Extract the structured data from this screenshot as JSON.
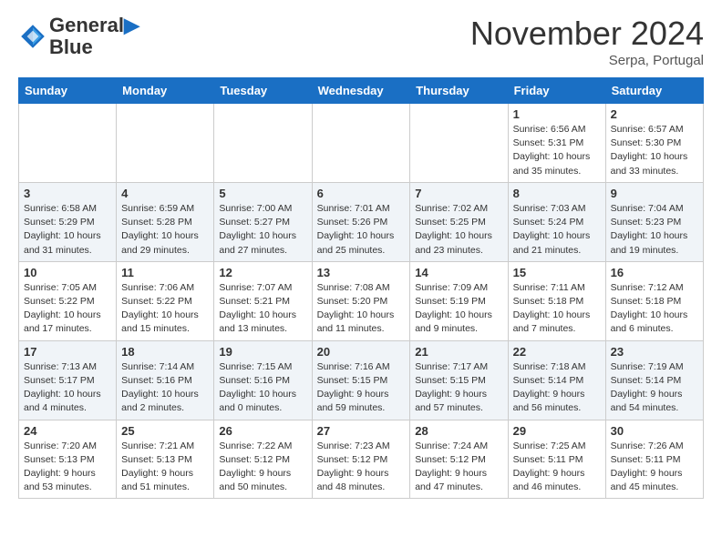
{
  "header": {
    "logo_line1": "General",
    "logo_line2": "Blue",
    "month": "November 2024",
    "location": "Serpa, Portugal"
  },
  "days_of_week": [
    "Sunday",
    "Monday",
    "Tuesday",
    "Wednesday",
    "Thursday",
    "Friday",
    "Saturday"
  ],
  "weeks": [
    [
      {
        "day": "",
        "info": ""
      },
      {
        "day": "",
        "info": ""
      },
      {
        "day": "",
        "info": ""
      },
      {
        "day": "",
        "info": ""
      },
      {
        "day": "",
        "info": ""
      },
      {
        "day": "1",
        "info": "Sunrise: 6:56 AM\nSunset: 5:31 PM\nDaylight: 10 hours and 35 minutes."
      },
      {
        "day": "2",
        "info": "Sunrise: 6:57 AM\nSunset: 5:30 PM\nDaylight: 10 hours and 33 minutes."
      }
    ],
    [
      {
        "day": "3",
        "info": "Sunrise: 6:58 AM\nSunset: 5:29 PM\nDaylight: 10 hours and 31 minutes."
      },
      {
        "day": "4",
        "info": "Sunrise: 6:59 AM\nSunset: 5:28 PM\nDaylight: 10 hours and 29 minutes."
      },
      {
        "day": "5",
        "info": "Sunrise: 7:00 AM\nSunset: 5:27 PM\nDaylight: 10 hours and 27 minutes."
      },
      {
        "day": "6",
        "info": "Sunrise: 7:01 AM\nSunset: 5:26 PM\nDaylight: 10 hours and 25 minutes."
      },
      {
        "day": "7",
        "info": "Sunrise: 7:02 AM\nSunset: 5:25 PM\nDaylight: 10 hours and 23 minutes."
      },
      {
        "day": "8",
        "info": "Sunrise: 7:03 AM\nSunset: 5:24 PM\nDaylight: 10 hours and 21 minutes."
      },
      {
        "day": "9",
        "info": "Sunrise: 7:04 AM\nSunset: 5:23 PM\nDaylight: 10 hours and 19 minutes."
      }
    ],
    [
      {
        "day": "10",
        "info": "Sunrise: 7:05 AM\nSunset: 5:22 PM\nDaylight: 10 hours and 17 minutes."
      },
      {
        "day": "11",
        "info": "Sunrise: 7:06 AM\nSunset: 5:22 PM\nDaylight: 10 hours and 15 minutes."
      },
      {
        "day": "12",
        "info": "Sunrise: 7:07 AM\nSunset: 5:21 PM\nDaylight: 10 hours and 13 minutes."
      },
      {
        "day": "13",
        "info": "Sunrise: 7:08 AM\nSunset: 5:20 PM\nDaylight: 10 hours and 11 minutes."
      },
      {
        "day": "14",
        "info": "Sunrise: 7:09 AM\nSunset: 5:19 PM\nDaylight: 10 hours and 9 minutes."
      },
      {
        "day": "15",
        "info": "Sunrise: 7:11 AM\nSunset: 5:18 PM\nDaylight: 10 hours and 7 minutes."
      },
      {
        "day": "16",
        "info": "Sunrise: 7:12 AM\nSunset: 5:18 PM\nDaylight: 10 hours and 6 minutes."
      }
    ],
    [
      {
        "day": "17",
        "info": "Sunrise: 7:13 AM\nSunset: 5:17 PM\nDaylight: 10 hours and 4 minutes."
      },
      {
        "day": "18",
        "info": "Sunrise: 7:14 AM\nSunset: 5:16 PM\nDaylight: 10 hours and 2 minutes."
      },
      {
        "day": "19",
        "info": "Sunrise: 7:15 AM\nSunset: 5:16 PM\nDaylight: 10 hours and 0 minutes."
      },
      {
        "day": "20",
        "info": "Sunrise: 7:16 AM\nSunset: 5:15 PM\nDaylight: 9 hours and 59 minutes."
      },
      {
        "day": "21",
        "info": "Sunrise: 7:17 AM\nSunset: 5:15 PM\nDaylight: 9 hours and 57 minutes."
      },
      {
        "day": "22",
        "info": "Sunrise: 7:18 AM\nSunset: 5:14 PM\nDaylight: 9 hours and 56 minutes."
      },
      {
        "day": "23",
        "info": "Sunrise: 7:19 AM\nSunset: 5:14 PM\nDaylight: 9 hours and 54 minutes."
      }
    ],
    [
      {
        "day": "24",
        "info": "Sunrise: 7:20 AM\nSunset: 5:13 PM\nDaylight: 9 hours and 53 minutes."
      },
      {
        "day": "25",
        "info": "Sunrise: 7:21 AM\nSunset: 5:13 PM\nDaylight: 9 hours and 51 minutes."
      },
      {
        "day": "26",
        "info": "Sunrise: 7:22 AM\nSunset: 5:12 PM\nDaylight: 9 hours and 50 minutes."
      },
      {
        "day": "27",
        "info": "Sunrise: 7:23 AM\nSunset: 5:12 PM\nDaylight: 9 hours and 48 minutes."
      },
      {
        "day": "28",
        "info": "Sunrise: 7:24 AM\nSunset: 5:12 PM\nDaylight: 9 hours and 47 minutes."
      },
      {
        "day": "29",
        "info": "Sunrise: 7:25 AM\nSunset: 5:11 PM\nDaylight: 9 hours and 46 minutes."
      },
      {
        "day": "30",
        "info": "Sunrise: 7:26 AM\nSunset: 5:11 PM\nDaylight: 9 hours and 45 minutes."
      }
    ]
  ]
}
